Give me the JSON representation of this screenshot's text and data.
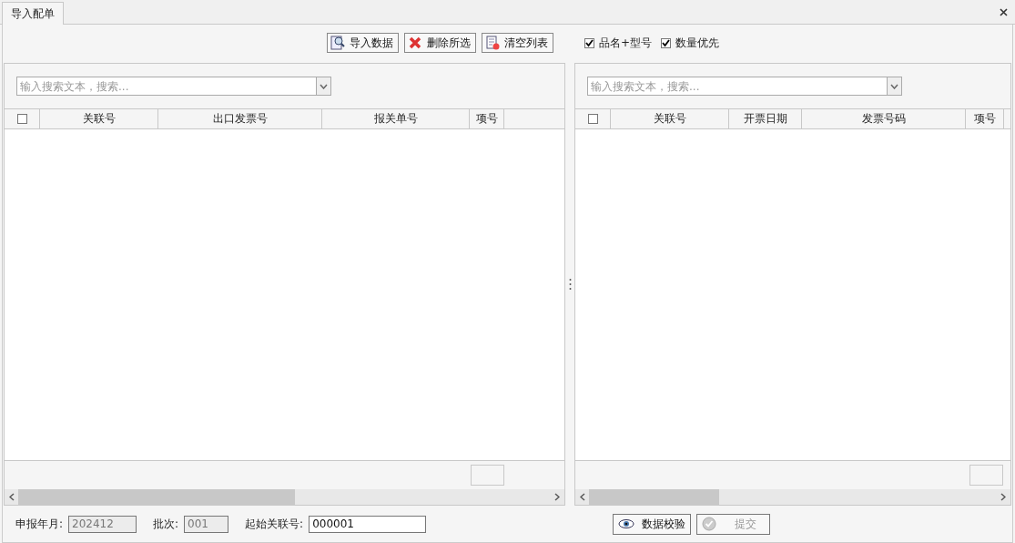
{
  "tabs": [
    {
      "label": "导入配单",
      "selected": true
    }
  ],
  "toolbar": {
    "buttons": [
      {
        "label": "导入数据",
        "kind": "import"
      },
      {
        "label": "删除所选",
        "kind": "delete"
      },
      {
        "label": "清空列表",
        "kind": "clear"
      }
    ],
    "options": [
      {
        "label": "品名+型号",
        "checked": true
      },
      {
        "label": "数量优先",
        "checked": true
      }
    ]
  },
  "panels": [
    {
      "search": {
        "placeholder": "输入搜索文本，搜索..."
      },
      "select_all": {
        "checked": false
      },
      "columns": [
        "关联号",
        "出口发票号",
        "报关单号",
        "项号"
      ]
    },
    {
      "search": {
        "placeholder": "输入搜索文本，搜索..."
      },
      "select_all": {
        "checked": false
      },
      "columns": [
        "关联号",
        "开票日期",
        "发票号码",
        "项号"
      ]
    }
  ],
  "footer": {
    "fields": [
      {
        "label": "申报年月:",
        "value": "202412",
        "disabled": true
      },
      {
        "label": "批次:",
        "value": "001",
        "disabled": true
      },
      {
        "label": "起始关联号:",
        "value": "000001",
        "disabled": false
      }
    ],
    "buttons": [
      {
        "label": "数据校验",
        "kind": "verify",
        "disabled": false
      },
      {
        "label": "提交",
        "kind": "submit",
        "disabled": true
      }
    ]
  }
}
